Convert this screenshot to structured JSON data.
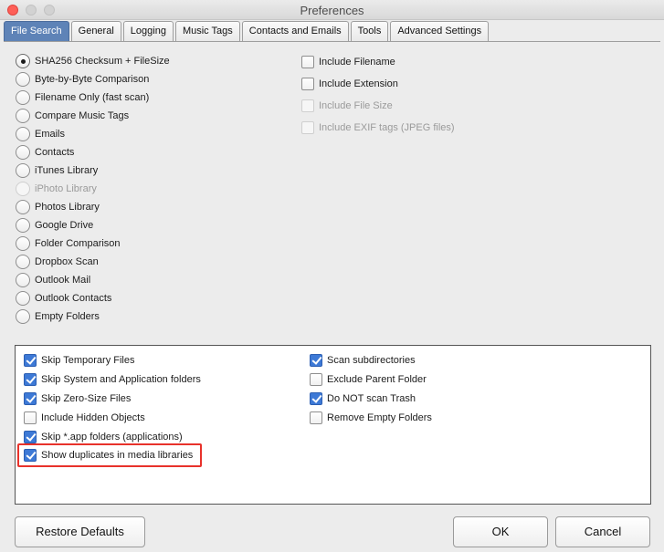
{
  "window": {
    "title": "Preferences"
  },
  "tabs": [
    {
      "label": "File Search",
      "active": true
    },
    {
      "label": "General",
      "active": false
    },
    {
      "label": "Logging",
      "active": false
    },
    {
      "label": "Music Tags",
      "active": false
    },
    {
      "label": "Contacts and Emails",
      "active": false
    },
    {
      "label": "Tools",
      "active": false
    },
    {
      "label": "Advanced Settings",
      "active": false
    }
  ],
  "scan_modes": [
    {
      "label": "SHA256 Checksum + FileSize",
      "selected": true,
      "enabled": true
    },
    {
      "label": "Byte-by-Byte Comparison",
      "selected": false,
      "enabled": true
    },
    {
      "label": "Filename Only (fast scan)",
      "selected": false,
      "enabled": true
    },
    {
      "label": "Compare Music Tags",
      "selected": false,
      "enabled": true
    },
    {
      "label": "Emails",
      "selected": false,
      "enabled": true
    },
    {
      "label": "Contacts",
      "selected": false,
      "enabled": true
    },
    {
      "label": "iTunes Library",
      "selected": false,
      "enabled": true
    },
    {
      "label": "iPhoto Library",
      "selected": false,
      "enabled": false
    },
    {
      "label": "Photos Library",
      "selected": false,
      "enabled": true
    },
    {
      "label": "Google Drive",
      "selected": false,
      "enabled": true
    },
    {
      "label": "Folder Comparison",
      "selected": false,
      "enabled": true
    },
    {
      "label": "Dropbox Scan",
      "selected": false,
      "enabled": true
    },
    {
      "label": "Outlook Mail",
      "selected": false,
      "enabled": true
    },
    {
      "label": "Outlook Contacts",
      "selected": false,
      "enabled": true
    },
    {
      "label": "Empty Folders",
      "selected": false,
      "enabled": true
    }
  ],
  "include_options": [
    {
      "label": "Include Filename",
      "checked": false,
      "enabled": true
    },
    {
      "label": "Include Extension",
      "checked": false,
      "enabled": true
    },
    {
      "label": "Include File Size",
      "checked": false,
      "enabled": false
    },
    {
      "label": "Include EXIF tags (JPEG files)",
      "checked": false,
      "enabled": false
    }
  ],
  "scan_options_left": [
    {
      "label": "Skip Temporary Files",
      "checked": true
    },
    {
      "label": "Skip System and Application folders",
      "checked": true
    },
    {
      "label": "Skip Zero-Size Files",
      "checked": true
    },
    {
      "label": "Include Hidden Objects",
      "checked": false
    },
    {
      "label": "Skip *.app folders (applications)",
      "checked": true
    },
    {
      "label": "Show duplicates in media libraries",
      "checked": true
    }
  ],
  "scan_options_right": [
    {
      "label": "Scan subdirectories",
      "checked": true
    },
    {
      "label": "Exclude Parent Folder",
      "checked": false
    },
    {
      "label": "Do NOT scan Trash",
      "checked": true
    },
    {
      "label": "Remove Empty Folders",
      "checked": false
    }
  ],
  "buttons": {
    "restore_defaults": "Restore Defaults",
    "ok": "OK",
    "cancel": "Cancel"
  },
  "colors": {
    "active_tab": "#5e83b7",
    "checkbox_checked": "#3d79d6",
    "highlight": "#e8322b"
  }
}
